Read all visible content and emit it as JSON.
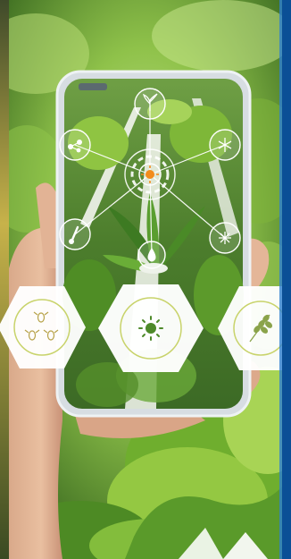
{
  "scene": {
    "description_hidden": false,
    "accent_color": "#0b6fc5",
    "frame_color": "#0b4f96",
    "leaf_light": "#a6d35a",
    "leaf_mid": "#6fae2e",
    "leaf_dark": "#2f6b1c",
    "hud_color": "#ffffff",
    "sun_color": "#f28c1c"
  },
  "hud": {
    "nodes": [
      {
        "name": "top-node",
        "icon": "plant-icon"
      },
      {
        "name": "upper-left-node",
        "icon": "molecule-icon"
      },
      {
        "name": "upper-right-node",
        "icon": "snowflake-icon"
      },
      {
        "name": "lower-left-node",
        "icon": "thermometer-icon"
      },
      {
        "name": "lower-right-node",
        "icon": "frost-icon"
      },
      {
        "name": "bottom-node",
        "icon": "droplet-icon"
      }
    ],
    "center_icon": "sun-target-icon"
  },
  "hexagons": [
    {
      "name": "pests-hexagon",
      "icon": "insects-icon"
    },
    {
      "name": "sun-hexagon",
      "icon": "sun-icon"
    },
    {
      "name": "grain-hexagon",
      "icon": "wheat-icon"
    }
  ]
}
